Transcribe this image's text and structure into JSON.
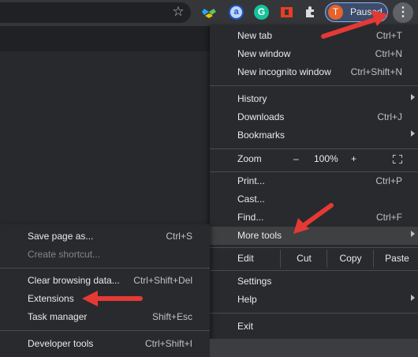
{
  "toolbar": {
    "star_icon": "star-icon",
    "extensions": [
      "dropbox-extension-icon",
      "ad-block-extension-icon",
      "grammarly-extension-icon",
      "office-extension-icon",
      "puzzle-icon"
    ],
    "ext_letters": {
      "ext2": "a",
      "ext3": "G"
    },
    "profile": {
      "initial": "T",
      "label": "Paused",
      "color": "#e8622c"
    },
    "menu_icon": "kebab-icon"
  },
  "main_menu": {
    "new_tab": {
      "label": "New tab",
      "shortcut": "Ctrl+T"
    },
    "new_window": {
      "label": "New window",
      "shortcut": "Ctrl+N"
    },
    "new_incognito": {
      "label": "New incognito window",
      "shortcut": "Ctrl+Shift+N"
    },
    "history": {
      "label": "History"
    },
    "downloads": {
      "label": "Downloads",
      "shortcut": "Ctrl+J"
    },
    "bookmarks": {
      "label": "Bookmarks"
    },
    "zoom": {
      "label": "Zoom",
      "minus": "–",
      "value": "100%",
      "plus": "+"
    },
    "print": {
      "label": "Print...",
      "shortcut": "Ctrl+P"
    },
    "cast": {
      "label": "Cast..."
    },
    "find": {
      "label": "Find...",
      "shortcut": "Ctrl+F"
    },
    "more_tools": {
      "label": "More tools"
    },
    "edit": {
      "label": "Edit",
      "cut": "Cut",
      "copy": "Copy",
      "paste": "Paste"
    },
    "settings": {
      "label": "Settings"
    },
    "help": {
      "label": "Help"
    },
    "exit": {
      "label": "Exit"
    }
  },
  "sub_menu": {
    "save_page": {
      "label": "Save page as...",
      "shortcut": "Ctrl+S"
    },
    "create_shortcut": {
      "label": "Create shortcut..."
    },
    "clear_browsing": {
      "label": "Clear browsing data...",
      "shortcut": "Ctrl+Shift+Del"
    },
    "extensions": {
      "label": "Extensions"
    },
    "task_manager": {
      "label": "Task manager",
      "shortcut": "Shift+Esc"
    },
    "developer_tools": {
      "label": "Developer tools",
      "shortcut": "Ctrl+Shift+I"
    }
  },
  "colors": {
    "menu_bg": "#292a2d",
    "highlight": "#3f4042",
    "accent_arrow": "#e53935"
  }
}
